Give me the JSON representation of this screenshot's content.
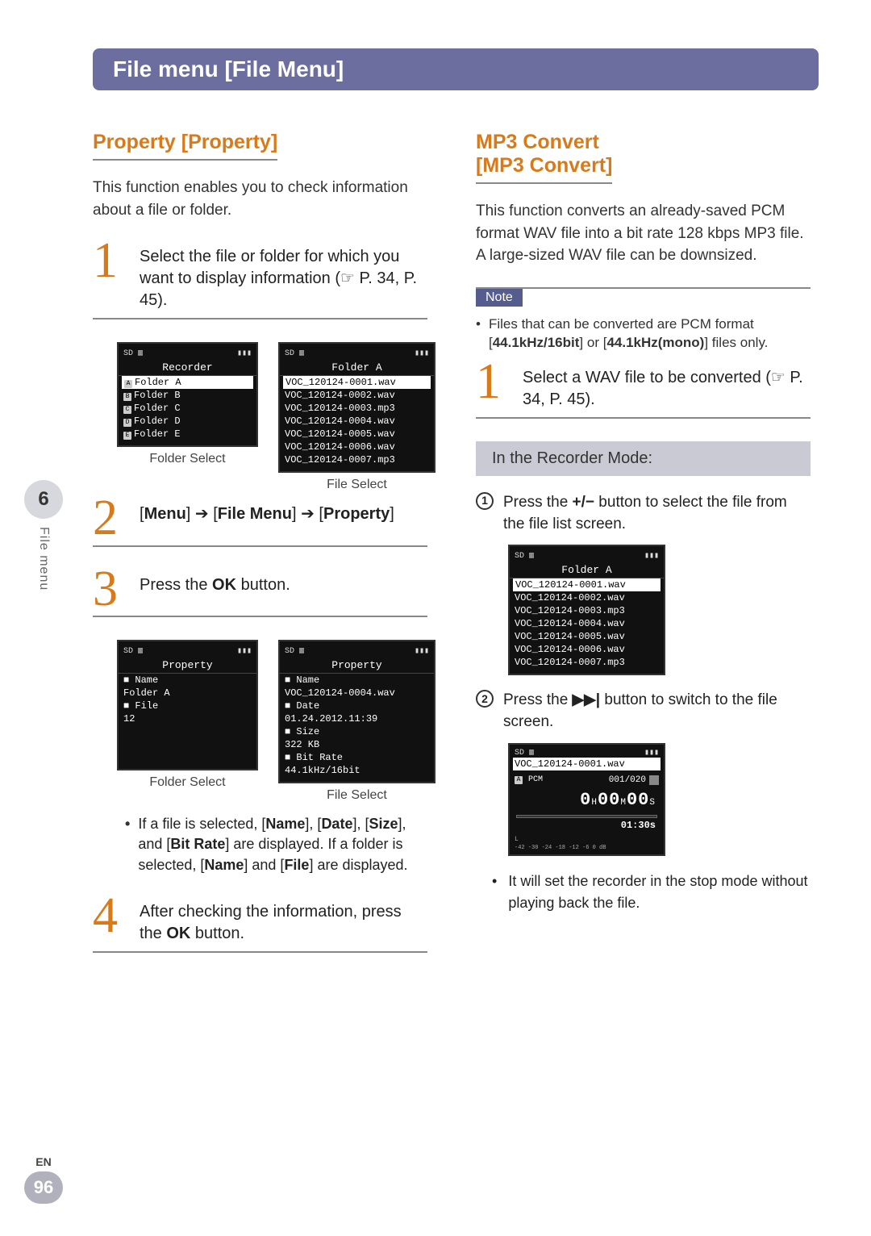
{
  "page": {
    "chapter_num": "6",
    "side_label": "File menu",
    "lang": "EN",
    "page_num": "96",
    "title_bar": "File menu [File Menu]"
  },
  "left": {
    "heading": "Property [Property]",
    "intro": "This function enables you to check information about a file or folder.",
    "step1": {
      "num": "1",
      "text": "Select the file or folder for which you want to display information (☞ P. 34, P. 45)."
    },
    "shot1a": {
      "title": "Recorder",
      "lines": [
        "Folder A",
        "Folder B",
        "Folder C",
        "Folder D",
        "Folder E"
      ],
      "badges": [
        "A",
        "B",
        "C",
        "D",
        "E"
      ],
      "caption": "Folder Select"
    },
    "shot1b": {
      "title": "Folder A",
      "lines": [
        "VOC_120124-0001.wav",
        "VOC_120124-0002.wav",
        "VOC_120124-0003.mp3",
        "VOC_120124-0004.wav",
        "VOC_120124-0005.wav",
        "VOC_120124-0006.wav",
        "VOC_120124-0007.mp3"
      ],
      "caption": "File Select"
    },
    "step2": {
      "num": "2",
      "text_parts": [
        "[",
        "Menu",
        "] ➔ [",
        "File Menu",
        "] ➔ [",
        "Property",
        "]"
      ]
    },
    "step3": {
      "num": "3",
      "text_pre": "Press the ",
      "ok": "OK",
      "text_post": " button."
    },
    "shot3a": {
      "title": "Property",
      "lines": [
        "■ Name",
        "Folder A",
        "■ File",
        " 12"
      ],
      "caption": "Folder Select"
    },
    "shot3b": {
      "title": "Property",
      "lines": [
        "■ Name",
        "VOC_120124-0004.wav",
        "■ Date",
        " 01.24.2012.11:39",
        "■ Size",
        " 322 KB",
        "■ Bit Rate",
        " 44.1kHz/16bit"
      ],
      "caption": "File Select"
    },
    "bullet": "If a file is selected, [Name], [Date], [Size], and [Bit Rate] are displayed. If a folder is selected, [Name] and [File] are displayed.",
    "bullet_html": [
      "If a file is selected, [",
      "Name",
      "], [",
      "Date",
      "], [",
      "Size",
      "], and [",
      "Bit Rate",
      "] are displayed. If a folder is selected, [",
      "Name",
      "] and [",
      "File",
      "] are displayed."
    ],
    "step4": {
      "num": "4",
      "text_pre": "After checking the information, press the ",
      "ok": "OK",
      "text_post": " button."
    }
  },
  "right": {
    "heading1": "MP3 Convert",
    "heading2": "[MP3 Convert]",
    "intro": "This function converts an already-saved PCM format WAV file into a bit rate 128 kbps MP3 file. A large-sized WAV file can be downsized.",
    "note_label": "Note",
    "note_text_parts": [
      "Files that can be converted are PCM format [",
      "44.1kHz/16bit",
      "] or [",
      "44.1kHz(mono)",
      "] files only."
    ],
    "step1": {
      "num": "1",
      "text": "Select a WAV file to be converted (☞ P. 34, P. 45)."
    },
    "mode_bar": "In the Recorder Mode:",
    "sub1": {
      "num": "1",
      "pre": "Press the ",
      "btn": "+/−",
      "post": " button to select the file from the file list screen."
    },
    "shot_list": {
      "title": "Folder A",
      "lines": [
        "VOC_120124-0001.wav",
        "VOC_120124-0002.wav",
        "VOC_120124-0003.mp3",
        "VOC_120124-0004.wav",
        "VOC_120124-0005.wav",
        "VOC_120124-0006.wav",
        "VOC_120124-0007.mp3"
      ]
    },
    "sub2": {
      "num": "2",
      "pre": "Press the ",
      "btn": "▶▶|",
      "post": " button to switch to the file screen."
    },
    "shot_play": {
      "filename": "VOC_120124-0001.wav",
      "counter": "001/020",
      "time_h": "0",
      "time_m": "00",
      "time_s": "00",
      "dur": "01:30",
      "scale": "-42  -30  -24  -18  -12   -6    0   dB"
    },
    "tail_bullet": "It will set the recorder in the stop mode without playing back the file."
  }
}
